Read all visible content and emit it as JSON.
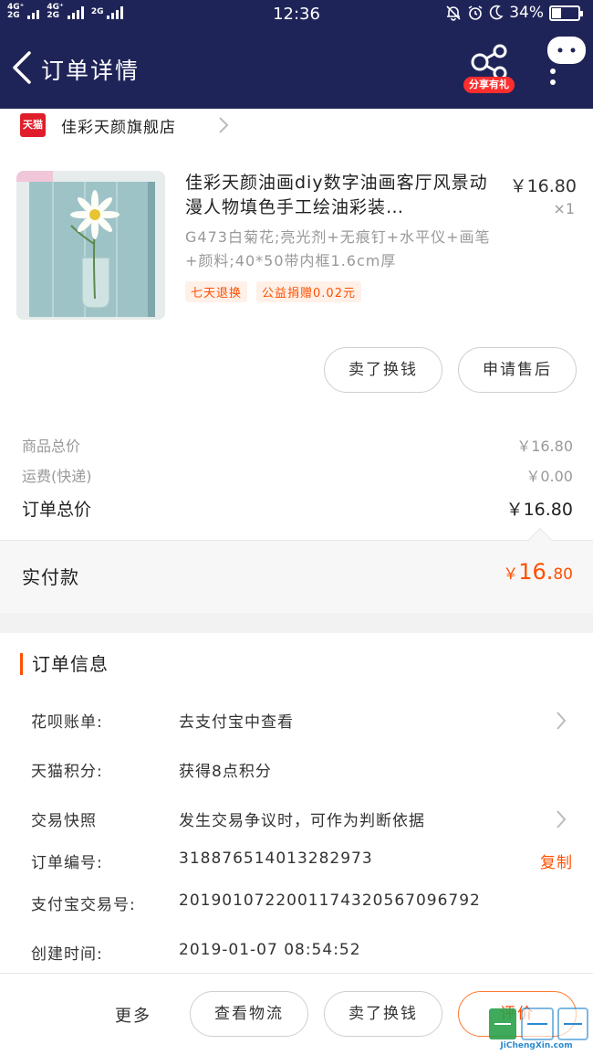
{
  "status_bar": {
    "network_1": "4G⁺",
    "network_1_sub": "2G",
    "network_2": "4G⁺",
    "network_2_sub": "2G",
    "network_3": "2G",
    "time": "12:36",
    "battery": "34%",
    "battery_level": 0.34
  },
  "nav": {
    "title": "订单详情",
    "share_badge": "分享有礼"
  },
  "shop": {
    "logo_text": "天猫",
    "name": "佳彩天颜旗舰店"
  },
  "product": {
    "title": "佳彩天颜油画diy数字油画客厅风景动漫人物填色手工绘油彩装…",
    "price": "￥16.80",
    "quantity": "×1",
    "sku": "G473白菊花;亮光剂+无痕钉+水平仪+画笔+颜料;40*50带内框1.6cm厚",
    "tags": [
      "七天退换",
      "公益捐赠0.02元"
    ]
  },
  "actions": {
    "sell": "卖了换钱",
    "after_sale": "申请售后"
  },
  "summary": {
    "goods_label": "商品总价",
    "goods_value": "￥16.80",
    "shipping_label": "运费(快递)",
    "shipping_value": "￥0.00",
    "total_label": "订单总价",
    "total_value": "￥16.80"
  },
  "payment": {
    "label": "实付款",
    "currency": "￥",
    "integer": "16.",
    "decimal": "80"
  },
  "order_info": {
    "title": "订单信息",
    "huabei_label": "花呗账单:",
    "huabei_value": "去支付宝中查看",
    "points_label": "天猫积分:",
    "points_value": "获得8点积分",
    "snapshot_label": "交易快照",
    "snapshot_value": "发生交易争议时，可作为判断依据",
    "order_no_label": "订单编号:",
    "order_no_value": "318876514013282973",
    "copy": "复制",
    "alipay_label": "支付宝交易号:",
    "alipay_value": "2019010722001174320567096792",
    "created_label": "创建时间:",
    "created_value": "2019-01-07 08:54:52"
  },
  "bottom": {
    "more": "更多",
    "logistics": "查看物流",
    "sell": "卖了换钱",
    "review": "评价"
  },
  "watermark": {
    "text": "JiChengXin.com"
  },
  "colors": {
    "header_bg": "#1f2458",
    "accent": "#ff5000",
    "tmall_red": "#e01d2b"
  }
}
